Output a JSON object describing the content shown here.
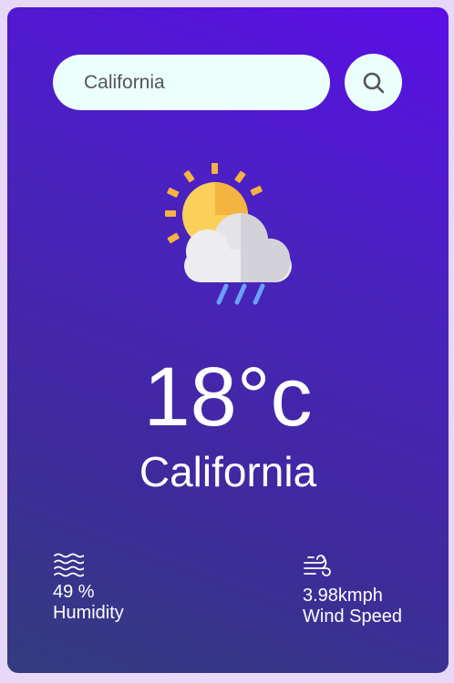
{
  "search": {
    "value": "California",
    "button_icon": "search-icon"
  },
  "weather": {
    "icon": "sun-cloud-rain-icon",
    "temperature": "18°c",
    "city": "California"
  },
  "details": {
    "humidity_value": "49 %",
    "humidity_label": "Humidity",
    "humidity_icon": "waves-icon",
    "wind_value": "3.98kmph",
    "wind_label": "Wind Speed",
    "wind_icon": "wind-icon"
  },
  "colors": {
    "gradient_top": "#5b0ee6",
    "gradient_bottom": "#323d7e",
    "search_bg": "#ebfffc",
    "page_bg": "#e6d8f6"
  }
}
